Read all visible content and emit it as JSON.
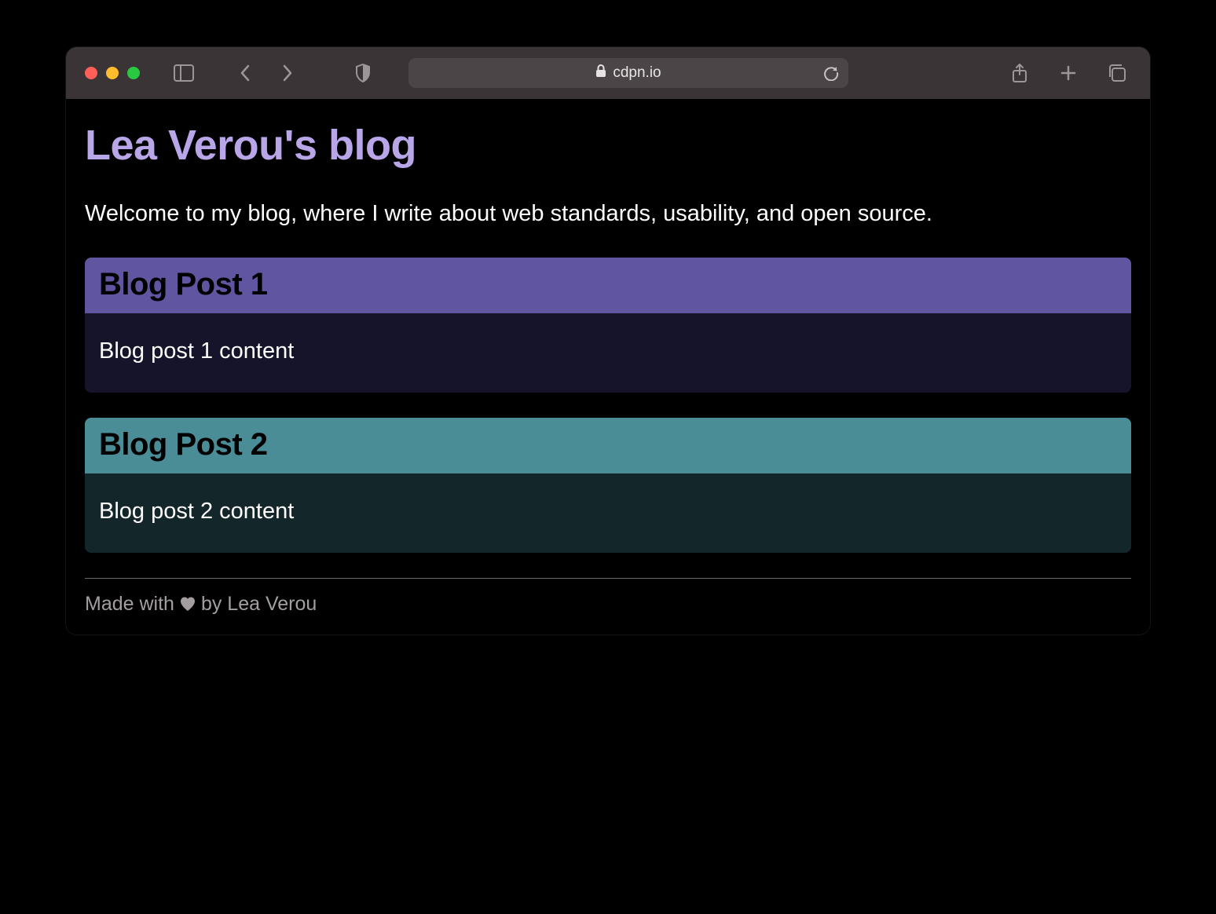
{
  "browser": {
    "domain": "cdpn.io"
  },
  "page": {
    "title": "Lea Verou's blog",
    "intro": "Welcome to my blog, where I write about web standards, usability, and open source.",
    "posts": [
      {
        "title": "Blog Post 1",
        "content": "Blog post 1 content"
      },
      {
        "title": "Blog Post 2",
        "content": "Blog post 2 content"
      }
    ],
    "footer": {
      "prefix": "Made with ",
      "suffix": " by Lea Verou"
    }
  }
}
